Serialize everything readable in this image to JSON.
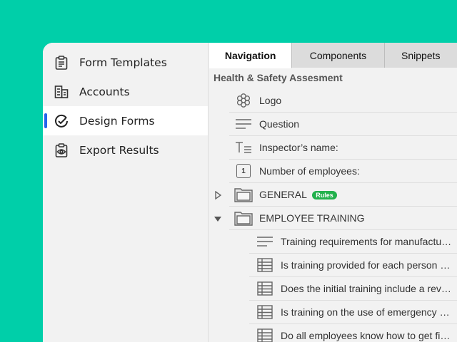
{
  "sidebar": {
    "items": [
      {
        "label": "Form Templates",
        "icon": "clipboard-list-icon"
      },
      {
        "label": "Accounts",
        "icon": "building-icon"
      },
      {
        "label": "Design Forms",
        "icon": "check-circle-icon",
        "active": true
      },
      {
        "label": "Export Results",
        "icon": "clipboard-eye-icon"
      }
    ]
  },
  "tabs": {
    "navigation": "Navigation",
    "components": "Components",
    "snippets": "Snippets"
  },
  "form": {
    "title": "Health & Safety Assesment"
  },
  "tree": {
    "logo": "Logo",
    "question": "Question",
    "inspector": "Inspector’s name:",
    "employees": "Number of employees:",
    "employees_icon_text": "1",
    "general": "GENERAL",
    "rules_badge": "Rules",
    "training": "EMPLOYEE TRAINING",
    "training_items": [
      "Training requirements for manufactu…",
      "Is training provided for each person …",
      "Does the initial training include a rev…",
      "Is training on the use of emergency …",
      "Do all employees know how to get fi…"
    ]
  },
  "colors": {
    "background": "#00cfa9",
    "active_indicator": "#2563eb",
    "rules_badge": "#22b14c"
  }
}
